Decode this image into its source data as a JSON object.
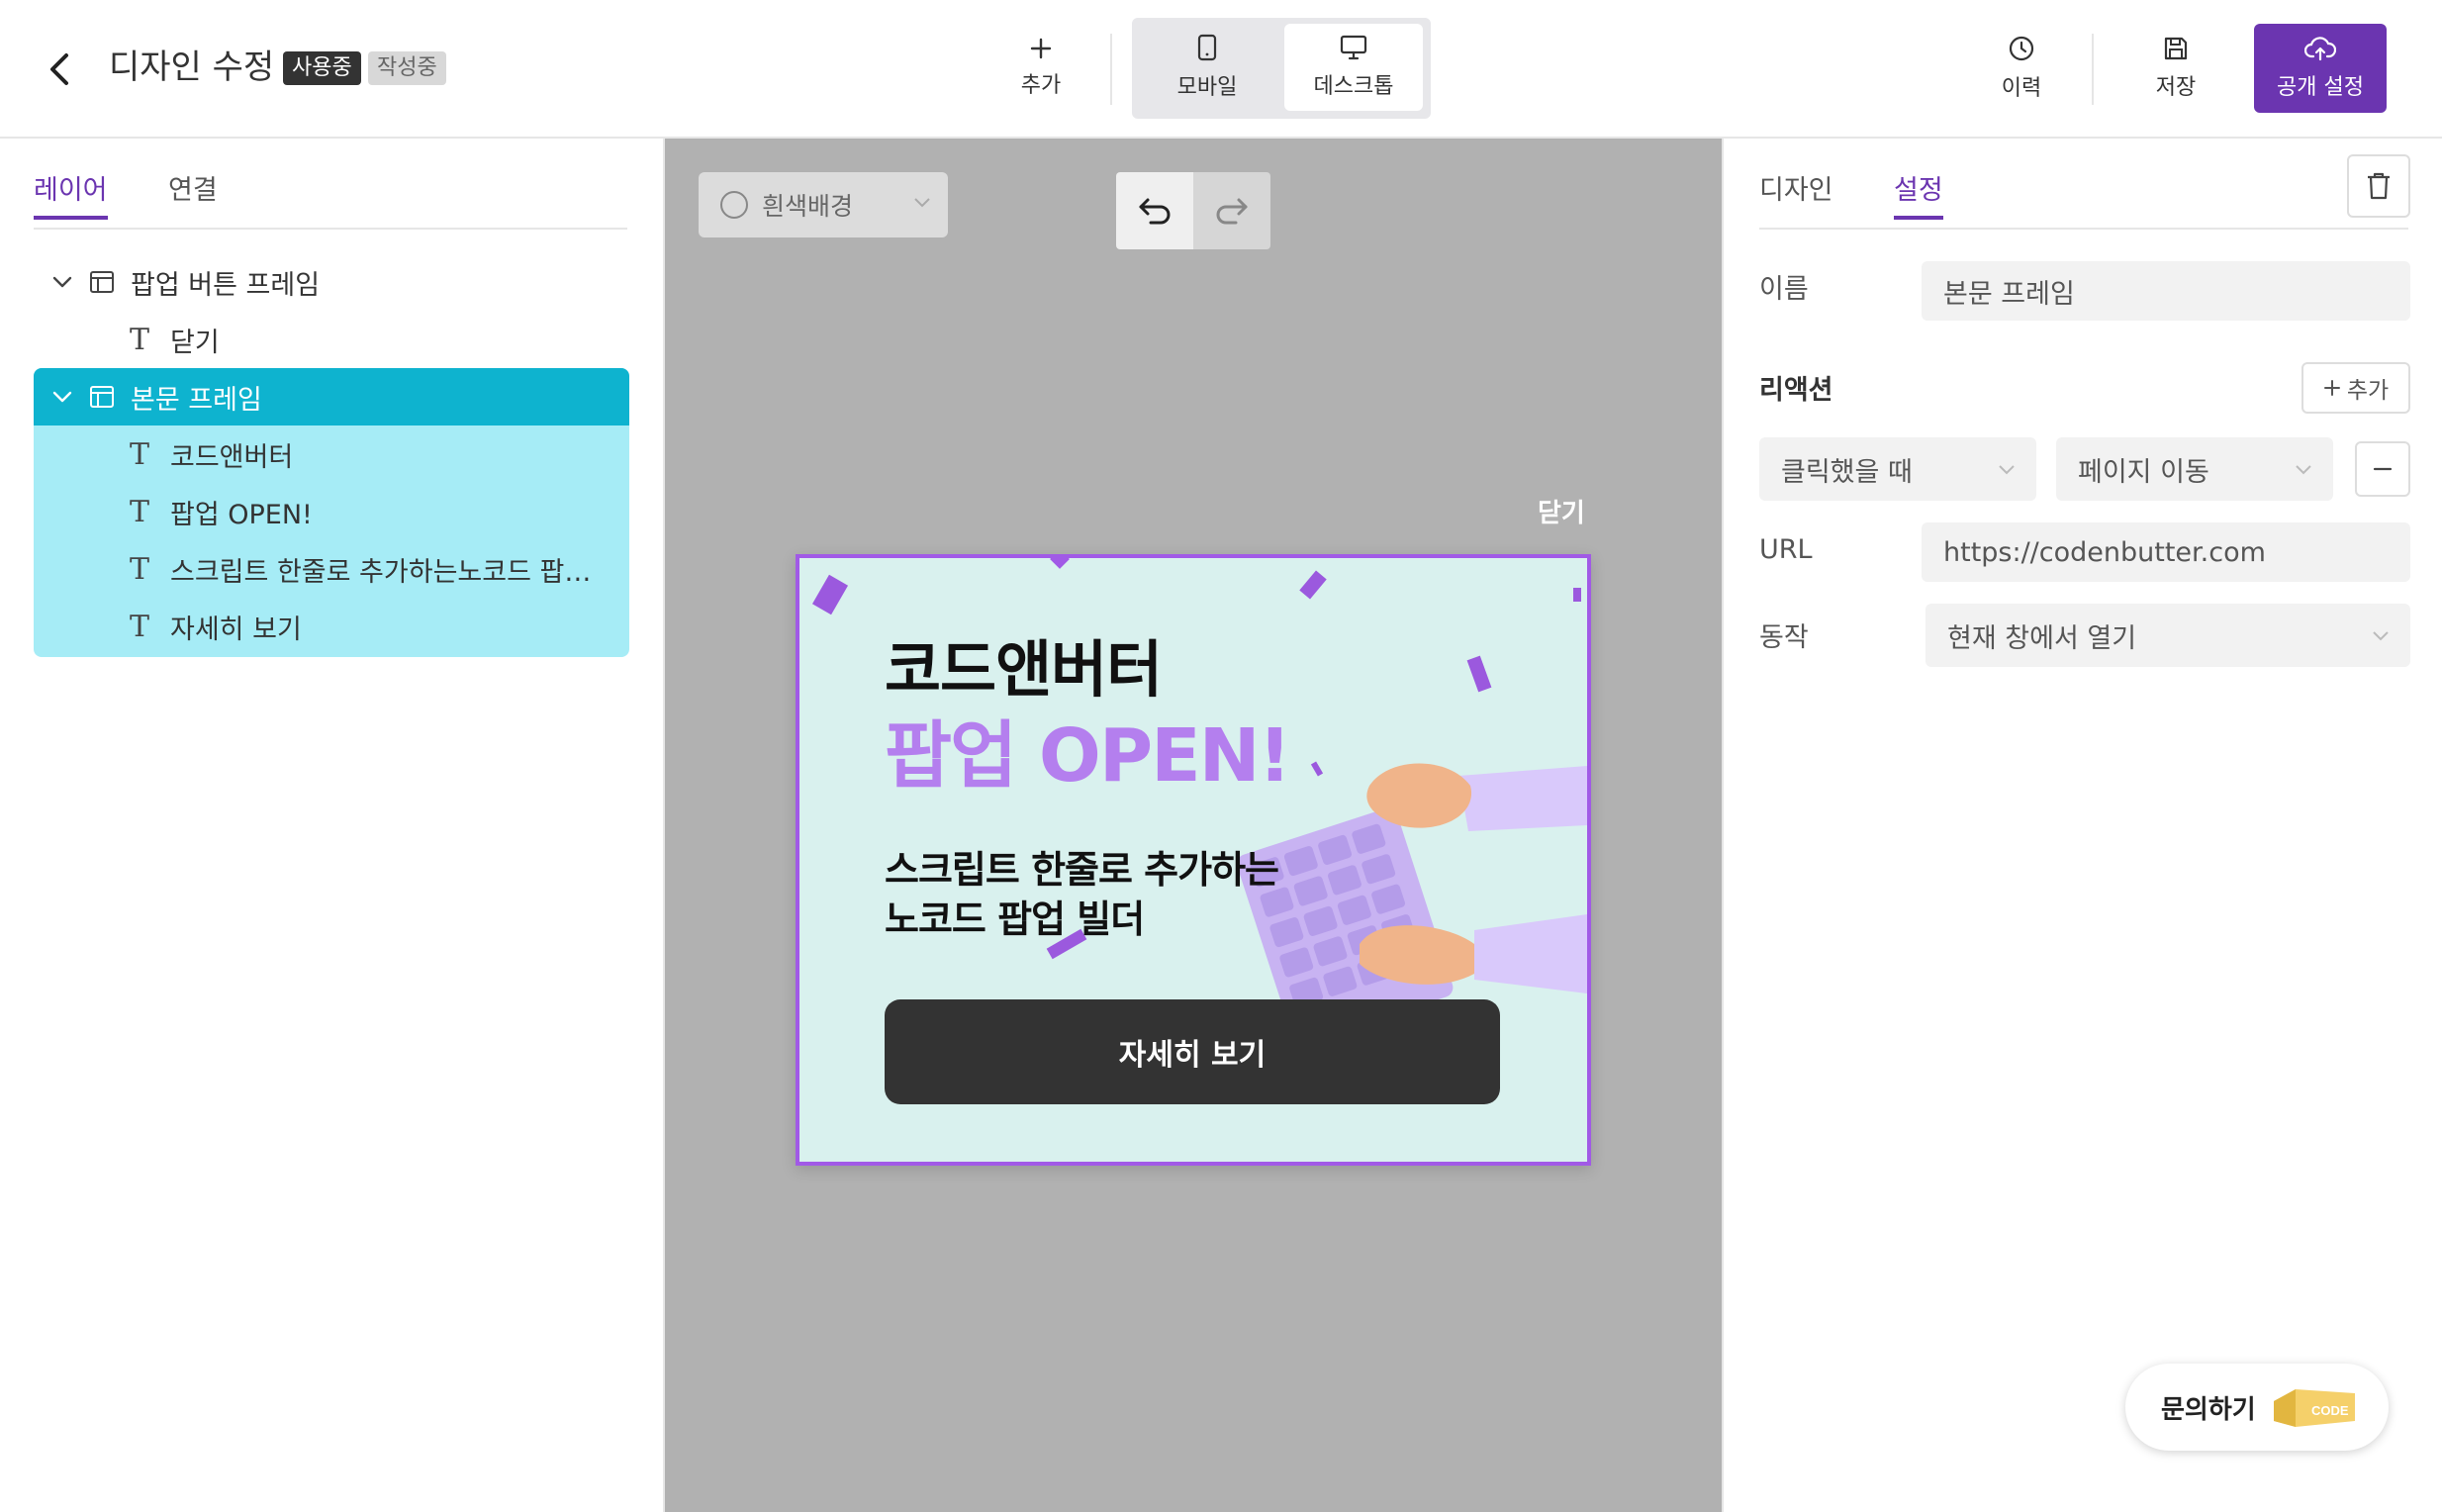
{
  "header": {
    "title": "디자인 수정",
    "badge_active": "사용중",
    "badge_draft": "작성중",
    "add_label": "추가",
    "mobile_label": "모바일",
    "desktop_label": "데스크톱",
    "selected_device": "desktop",
    "history_label": "이력",
    "save_label": "저장",
    "publish_label": "공개 설정"
  },
  "left_panel": {
    "tabs": [
      {
        "label": "레이어",
        "active": true
      },
      {
        "label": "연결",
        "active": false
      }
    ],
    "layers": [
      {
        "type": "frame",
        "label": "팝업 버튼 프레임",
        "expanded": true,
        "selected": false
      },
      {
        "type": "text",
        "label": "닫기"
      },
      {
        "type": "frame",
        "label": "본문 프레임",
        "expanded": true,
        "selected": true
      },
      {
        "type": "text",
        "label": "코드앤버터"
      },
      {
        "type": "text",
        "label": "팝업 OPEN!"
      },
      {
        "type": "text",
        "label": "스크립트 한줄로 추가하는노코드 팝업 ..."
      },
      {
        "type": "text",
        "label": "자세히 보기"
      }
    ]
  },
  "canvas": {
    "bg_toggle_label": "흰색배경",
    "bg_toggle_checked": false,
    "close_label": "닫기",
    "popup": {
      "brand": "코드앤버터",
      "headline": "팝업 OPEN!",
      "desc_line1": "스크립트 한줄로 추가하는",
      "desc_line2": "노코드 팝업 빌더",
      "cta": "자세히 보기",
      "accent_color": "#b47fee",
      "bg_color": "#d9f1ee"
    }
  },
  "right_panel": {
    "tabs": [
      {
        "label": "디자인",
        "active": false
      },
      {
        "label": "설정",
        "active": true
      }
    ],
    "name_label": "이름",
    "name_value": "본문 프레임",
    "reaction_title": "리액션",
    "reaction_add_label": "추가",
    "trigger_value": "클릭했을 때",
    "action_value": "페이지 이동",
    "url_label": "URL",
    "url_value": "https://codenbutter.com",
    "behavior_label": "동작",
    "behavior_value": "현재 창에서 열기"
  },
  "support": {
    "label": "문의하기",
    "logo_text": "CODE"
  },
  "colors": {
    "brand_purple": "#6b35b0",
    "selection_cyan": "#0eb3cf",
    "selection_light": "#a6ecf6",
    "canvas_gray": "#b1b1b1"
  }
}
